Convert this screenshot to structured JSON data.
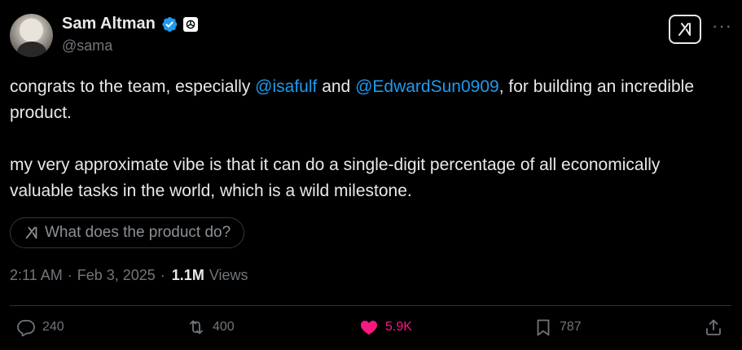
{
  "author": {
    "name": "Sam Altman",
    "handle": "@sama",
    "verified_color": "#1d9bf0"
  },
  "header": {
    "grok_icon": "grok-icon",
    "more_label": "···"
  },
  "tweet": {
    "line1_pre": "congrats to the team, especially ",
    "mention1": "@isafulf",
    "line1_mid": " and ",
    "mention2": "@EdwardSun0909",
    "line1_post": ", for building an incredible product.",
    "paragraph2": "my very approximate vibe is that it can do a single-digit percentage of all economically valuable tasks in the world, which is a wild milestone."
  },
  "grok_prompt": {
    "label": "What does the product do?"
  },
  "meta": {
    "time": "2:11 AM",
    "sep1": "·",
    "date": "Feb 3, 2025",
    "sep2": "·",
    "views_count": "1.1M",
    "views_label": "Views"
  },
  "actions": {
    "replies": "240",
    "reposts": "400",
    "likes": "5.9K",
    "bookmarks": "787"
  },
  "colors": {
    "background": "#000000",
    "text": "#e7e9ea",
    "secondary": "#71767b",
    "link": "#1d9bf0",
    "like": "#f91880"
  }
}
